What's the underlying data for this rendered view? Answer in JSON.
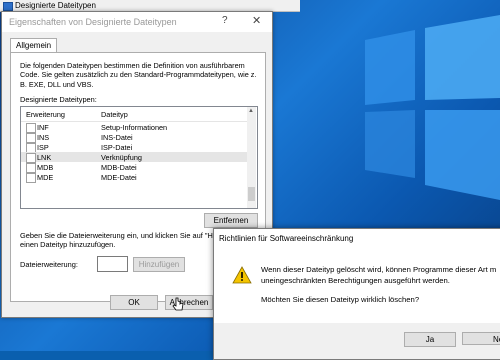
{
  "background_window": {
    "title": "Designierte Dateitypen"
  },
  "properties_dialog": {
    "title": "Eigenschaften von Designierte Dateitypen",
    "help_symbol": "?",
    "close_symbol": "✕",
    "tab": "Allgemein",
    "description": "Die folgenden Dateitypen bestimmen die Definition von ausführbarem Code. Sie gelten zusätzlich zu den Standard-Programmdateitypen, wie z. B. EXE, DLL und VBS.",
    "list_label": "Designierte Dateitypen:",
    "columns": [
      "Erweiterung",
      "Dateityp"
    ],
    "rows": [
      {
        "ext": "INF",
        "type": "Setup-Informationen",
        "selected": false
      },
      {
        "ext": "INS",
        "type": "INS-Datei",
        "selected": false
      },
      {
        "ext": "ISP",
        "type": "ISP-Datei",
        "selected": false
      },
      {
        "ext": "LNK",
        "type": "Verknüpfung",
        "selected": true
      },
      {
        "ext": "MDB",
        "type": "MDB-Datei",
        "selected": false
      },
      {
        "ext": "MDE",
        "type": "MDE-Datei",
        "selected": false
      }
    ],
    "remove_button": "Entfernen",
    "add_instruction": "Geben Sie die Dateierweiterung ein, und klicken Sie auf \"Hinzu",
    "add_instruction_line2": "einen Dateityp hinzuzufügen.",
    "extension_label": "Dateierweiterung:",
    "add_button": "Hinzufügen",
    "ok_button": "OK",
    "cancel_button": "Abbrechen"
  },
  "confirm_dialog": {
    "title": "Richtlinien für Softwareeinschränkung",
    "message_line1": "Wenn dieser Dateityp gelöscht wird, können Programme dieser Art m",
    "message_line2": "uneingeschränkten Berechtigungen ausgeführt werden.",
    "question": "Möchten Sie diesen Dateityp wirklich löschen?",
    "yes_button": "Ja",
    "no_button": "Nei"
  },
  "colors": {
    "desktop_blue": "#0a5fae",
    "selection_gray": "#e5e5e5",
    "warning_yellow": "#f4c400"
  }
}
